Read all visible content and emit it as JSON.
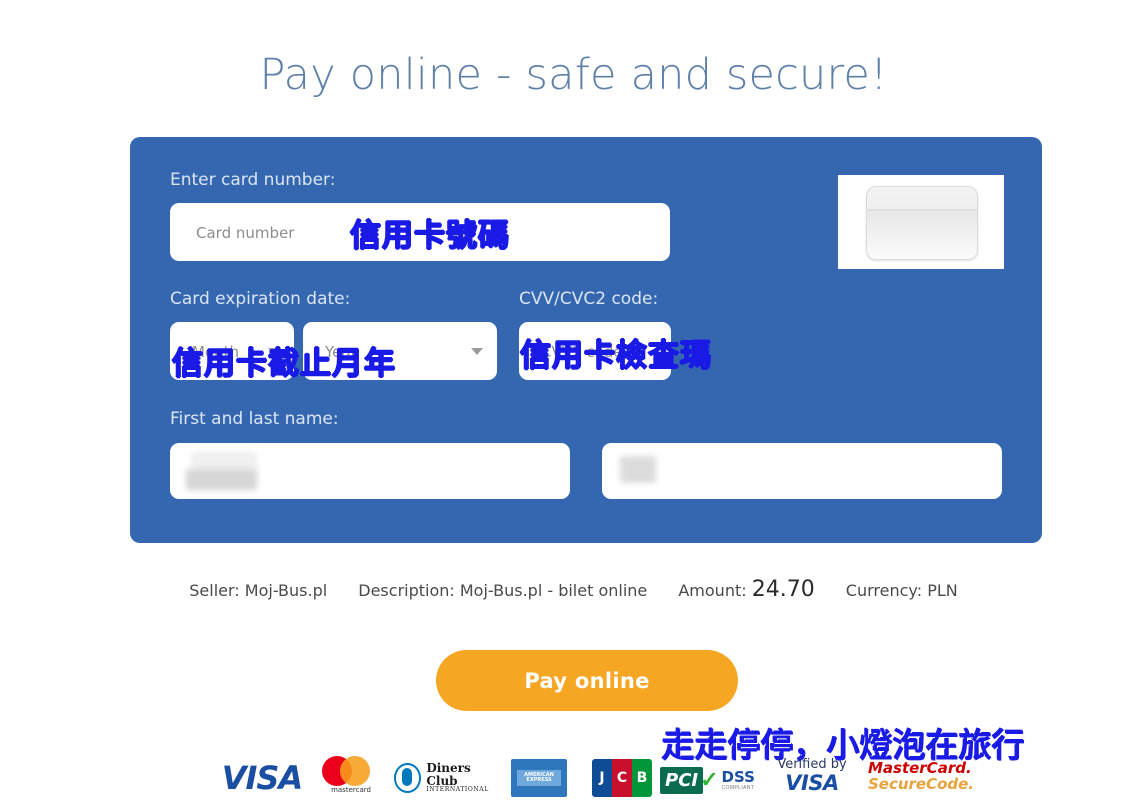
{
  "page": {
    "title": "Pay online - safe and secure!"
  },
  "form": {
    "card_number": {
      "label": "Enter card number:",
      "placeholder": "Card number",
      "value": "",
      "annotation": "信用卡號碼"
    },
    "expiration": {
      "label": "Card expiration date:",
      "month_placeholder": "Month",
      "year_placeholder": "Year",
      "month_value": "",
      "year_value": "",
      "annotation": "信用卡截止月年"
    },
    "cvv": {
      "label": "CVV/CVC2 code:",
      "placeholder": "CVV2 code",
      "value": "",
      "annotation": "信用卡檢查瑪"
    },
    "name": {
      "label": "First and last name:",
      "first_value": "",
      "last_value": ""
    },
    "card_thumbnail_icon": "credit-card-icon"
  },
  "summary": {
    "seller_label": "Seller:",
    "seller_value": "Moj-Bus.pl",
    "description_label": "Description:",
    "description_value": "Moj-Bus.pl - bilet online",
    "amount_label": "Amount:",
    "amount_value": "24.70",
    "currency_label": "Currency:",
    "currency_value": "PLN"
  },
  "actions": {
    "pay_button": "Pay online"
  },
  "watermark": "走走停停，小燈泡在旅行",
  "logos": [
    {
      "name": "visa-logo",
      "text": "VISA"
    },
    {
      "name": "mastercard-logo",
      "text": "mastercard"
    },
    {
      "name": "diners-club-logo",
      "text": "Diners Club",
      "sub": "INTERNATIONAL"
    },
    {
      "name": "american-express-logo",
      "text": "AMERICAN EXPRESS"
    },
    {
      "name": "jcb-logo",
      "text": "JCB"
    },
    {
      "name": "pci-dss-logo",
      "text": "PCI",
      "sub": "DSS",
      "sub2": "COMPLIANT"
    },
    {
      "name": "verified-by-visa-logo",
      "text": "Verified by",
      "sub": "VISA"
    },
    {
      "name": "mastercard-securecode-logo",
      "text": "MasterCard.",
      "sub": "SecureCode."
    }
  ],
  "colors": {
    "panel_blue": "#3566b0",
    "title_blue": "#5d7fa8",
    "button_orange": "#f5a623",
    "annotation_blue": "#1a1ae6"
  }
}
